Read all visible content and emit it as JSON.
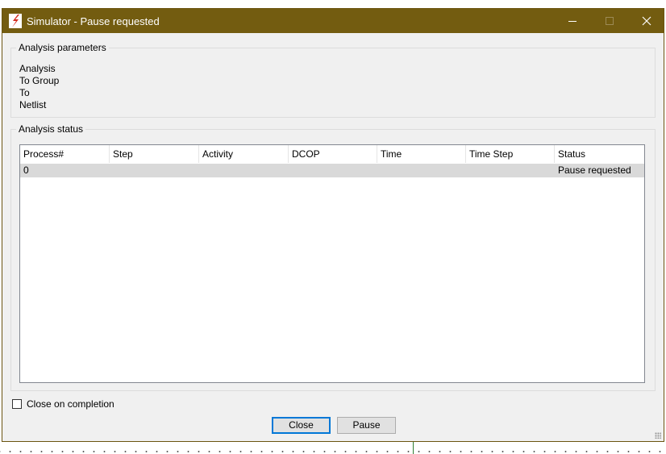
{
  "window": {
    "title": "Simulator - Pause requested",
    "brand_color": "#735c10"
  },
  "title_buttons": {
    "minimize": "minimize-icon",
    "maximize": "maximize-icon",
    "close": "close-icon"
  },
  "params": {
    "group_title": "Analysis parameters",
    "labels": [
      "Analysis",
      "To Group",
      "To",
      "Netlist"
    ]
  },
  "status": {
    "group_title": "Analysis status",
    "columns": [
      "Process#",
      "Step",
      "Activity",
      "DCOP",
      "Time",
      "Time Step",
      "Status"
    ],
    "rows": [
      {
        "process": "0",
        "step": "",
        "activity": "",
        "dcop": "",
        "time": "",
        "time_step": "",
        "status": "Pause requested"
      }
    ]
  },
  "options": {
    "close_on_completion_label": "Close on completion",
    "close_on_completion_checked": false
  },
  "buttons": {
    "close_label": "Close",
    "pause_label": "Pause"
  }
}
